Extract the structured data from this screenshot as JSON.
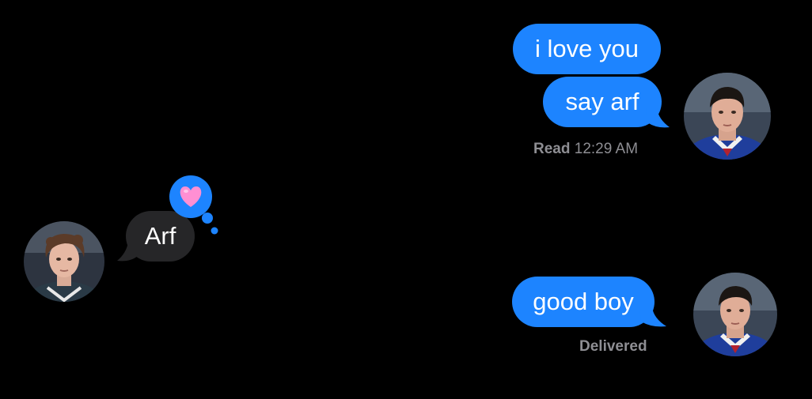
{
  "conversation": {
    "messages": [
      {
        "sender": "me",
        "text": "i love you"
      },
      {
        "sender": "me",
        "text": "say arf"
      },
      {
        "sender": "them",
        "text": "Arf",
        "reaction": "heart-emoji"
      },
      {
        "sender": "me",
        "text": "good boy"
      }
    ],
    "read_receipt": {
      "label": "Read",
      "time": "12:29 AM"
    },
    "delivered_label": "Delivered"
  },
  "colors": {
    "sent_bubble": "#1d84ff",
    "received_bubble": "#262628",
    "background": "#000000",
    "status_text": "#8e8e93",
    "heart": "#ff8fd3"
  }
}
